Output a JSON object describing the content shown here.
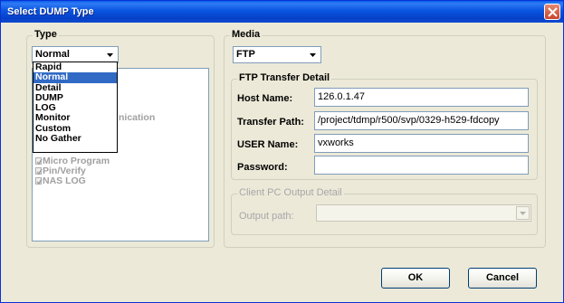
{
  "window": {
    "title": "Select DUMP Type"
  },
  "type_group": {
    "label": "Type",
    "selected": "Normal",
    "options": [
      {
        "label": "Rapid",
        "selected": false
      },
      {
        "label": "Normal",
        "selected": true
      },
      {
        "label": "Detail",
        "selected": false
      },
      {
        "label": "DUMP",
        "selected": false
      },
      {
        "label": "LOG",
        "selected": false
      },
      {
        "label": "Monitor",
        "selected": false
      },
      {
        "label": "Custom",
        "selected": false
      },
      {
        "label": "No Gather",
        "selected": false
      }
    ],
    "list_partial_text": "nication",
    "list_items": [
      {
        "label": "Micro Program",
        "checked": true
      },
      {
        "label": "Pin/Verify",
        "checked": true
      },
      {
        "label": "NAS LOG",
        "checked": true
      }
    ]
  },
  "media_group": {
    "label": "Media",
    "selected": "FTP"
  },
  "ftp_group": {
    "label": "FTP Transfer Detail",
    "host_label": "Host Name:",
    "host_value": "126.0.1.47",
    "path_label": "Transfer Path:",
    "path_value": "/project/tdmp/r500/svp/0329-h529-fdcopy",
    "user_label": "USER Name:",
    "user_value": "vxworks",
    "password_label": "Password:",
    "password_value": ""
  },
  "client_group": {
    "label": "Client PC Output Detail",
    "output_label": "Output path:",
    "output_value": ""
  },
  "buttons": {
    "ok": "OK",
    "cancel": "Cancel"
  },
  "colors": {
    "titlebar": "#0a55df",
    "selection": "#316ac5",
    "dialog_bg": "#ece9d8"
  }
}
